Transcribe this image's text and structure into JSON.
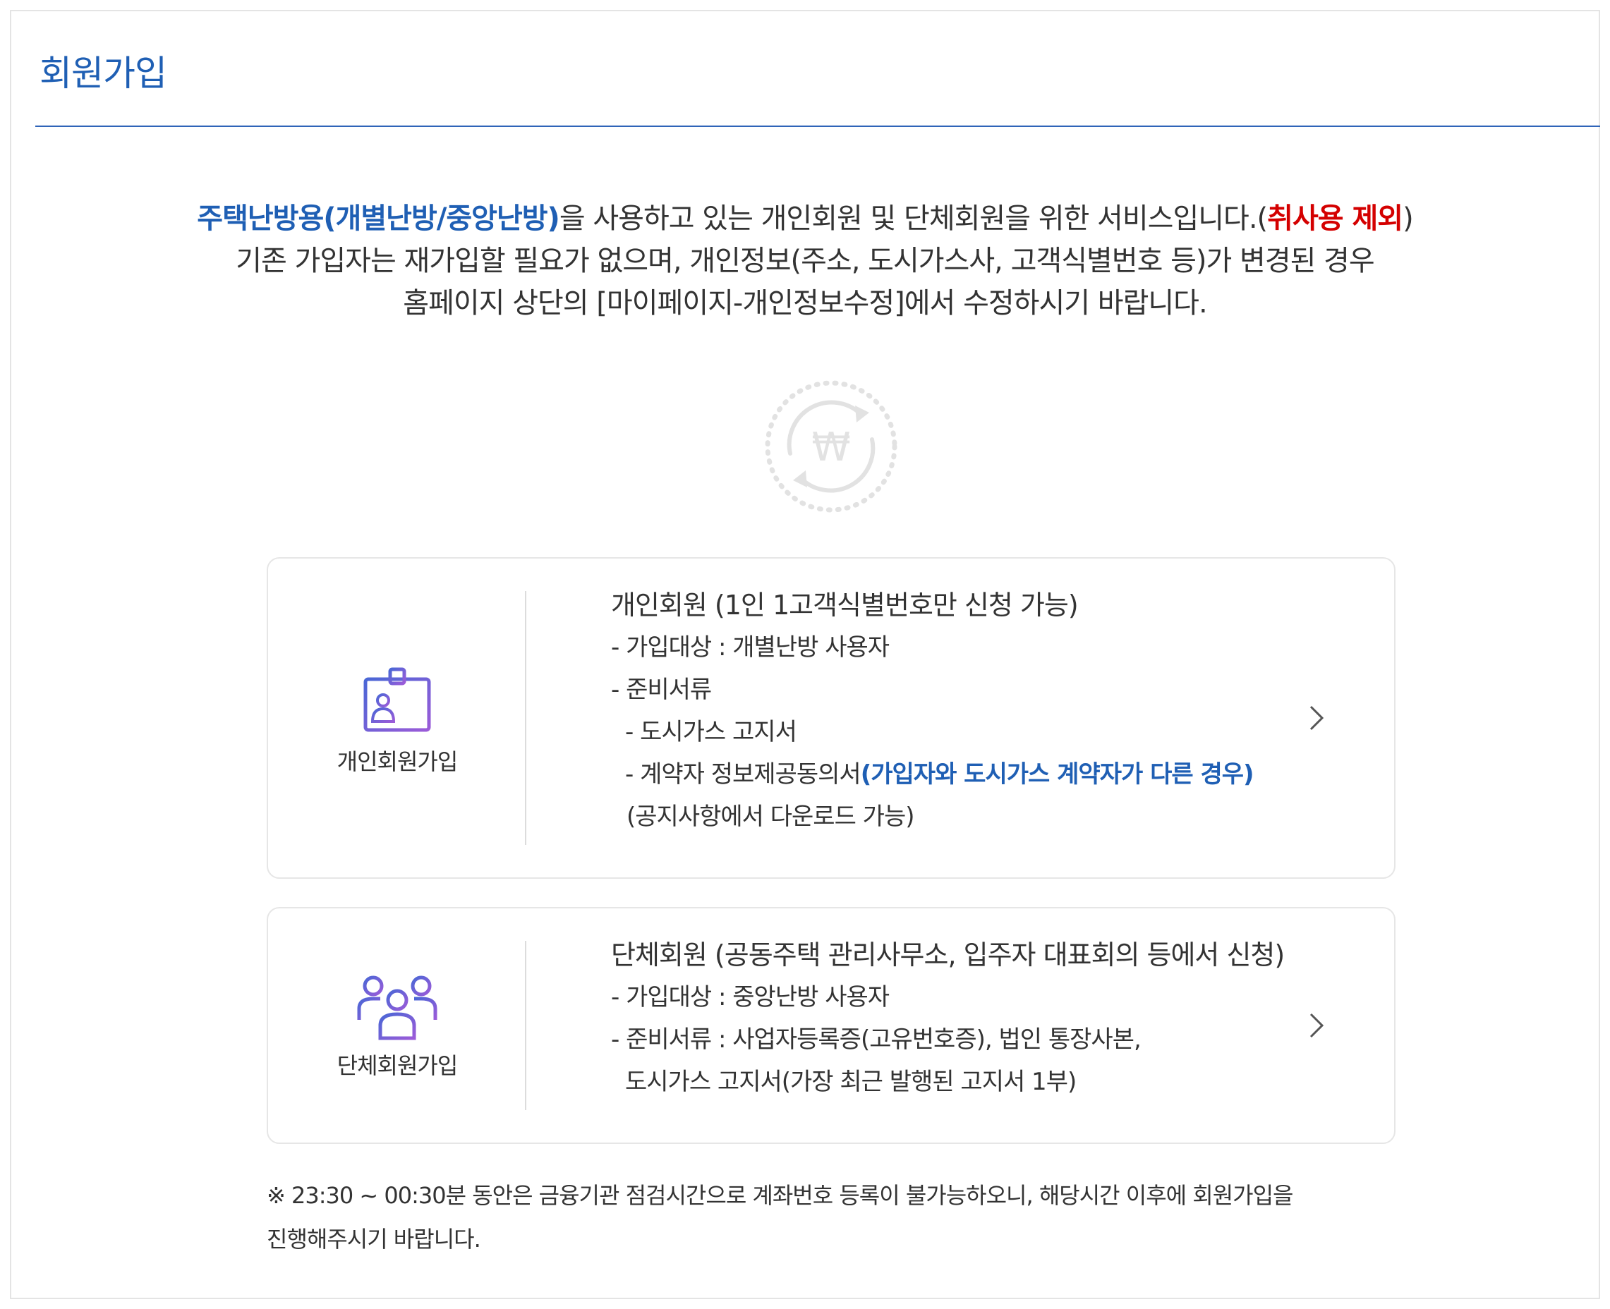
{
  "page": {
    "title": "회원가입"
  },
  "intro": {
    "line1_blue": "주택난방용(개별난방/중앙난방)",
    "line1_mid": "을 사용하고 있는 개인회원 및 단체회원을 위한 서비스입니다.(",
    "line1_red": "취사용 제외",
    "line1_end": ")",
    "line2": "기존 가입자는 재가입할 필요가 없으며, 개인정보(주소, 도시가스사, 고객식별번호 등)가 변경된 경우",
    "line3": "홈페이지 상단의 [마이페이지-개인정보수정]에서 수정하시기 바랍니다."
  },
  "emblem": {
    "icon": "won-cycle-icon",
    "glyph": "₩"
  },
  "cards": [
    {
      "icon": "id-badge-icon",
      "label": "개인회원가입",
      "heading": "개인회원 (1인 1고객식별번호만 신청 가능)",
      "target": "- 가입대상 : 개별난방 사용자",
      "docs_title": "- 준비서류",
      "doc1": "- 도시가스 고지서",
      "doc2_text": "- 계약자 정보제공동의서",
      "doc2_blue": "(가입자와 도시가스 계약자가 다른 경우)",
      "doc2_note": "(공지사항에서 다운로드 가능)",
      "chevron": "chevron-right-icon"
    },
    {
      "icon": "group-users-icon",
      "label": "단체회원가입",
      "heading": "단체회원 (공동주택 관리사무소, 입주자 대표회의 등에서 신청)",
      "target": "- 가입대상 : 중앙난방 사용자",
      "docs": "- 준비서류 : 사업자등록증(고유번호증), 법인 통장사본,",
      "docs_cont": "도시가스 고지서(가장 최근 발행된 고지서 1부)",
      "chevron": "chevron-right-icon"
    }
  ],
  "notice": {
    "line1": "※ 23:30 ~ 00:30분 동안은 금융기관 점검시간으로 계좌번호 등록이 불가능하오니, 해당시간 이후에 회원가입을",
    "line2": "진행해주시기 바랍니다."
  },
  "colors": {
    "accent": "#1f5fb4",
    "warning": "#d40000",
    "icon_start": "#4a67d6",
    "icon_end": "#9b5bd8"
  }
}
